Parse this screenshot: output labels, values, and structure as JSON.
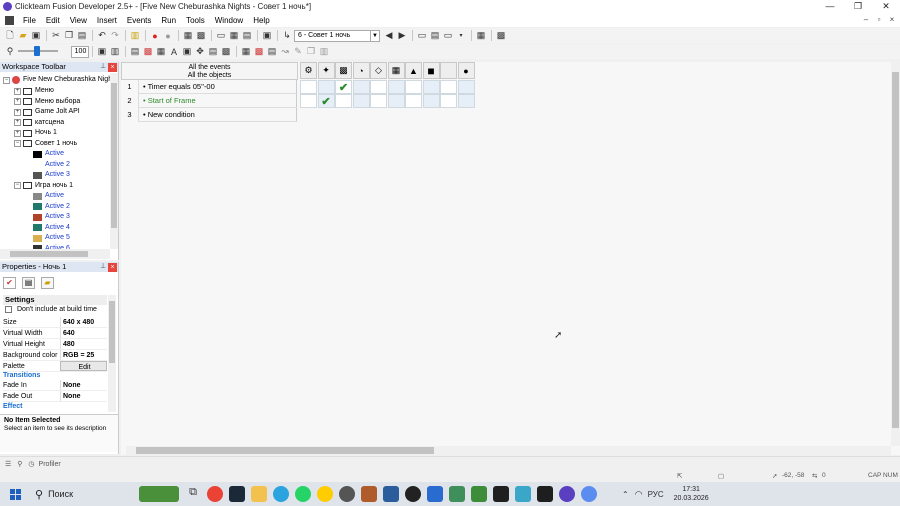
{
  "window": {
    "title": "Clickteam Fusion Developer 2.5+ - [Five New Cheburashka Nights - Совет 1 ночь*]",
    "minimize": "—",
    "restore": "❐",
    "close": "✕"
  },
  "menu": [
    "File",
    "Edit",
    "View",
    "Insert",
    "Events",
    "Run",
    "Tools",
    "Window",
    "Help"
  ],
  "toolbar": {
    "frame_combo": "6 - Совет 1 ночь",
    "zoom_value": "100"
  },
  "workspace": {
    "header": "Workspace Toolbar",
    "root": "Five New Cheburashka Nigh",
    "items": [
      {
        "label": "Меню",
        "level": 1,
        "expand": "+"
      },
      {
        "label": "Меню выбора",
        "level": 1,
        "expand": "+"
      },
      {
        "label": "Game Jolt API",
        "level": 1,
        "expand": "+"
      },
      {
        "label": "катсцена",
        "level": 1,
        "expand": "+"
      },
      {
        "label": "Ночь 1",
        "level": 1,
        "expand": "+"
      },
      {
        "label": "Совет 1 ночь",
        "level": 1,
        "expand": "−"
      },
      {
        "label": "Active",
        "level": 2,
        "expand": ""
      },
      {
        "label": "Active 2",
        "level": 2,
        "expand": ""
      },
      {
        "label": "Active 3",
        "level": 2,
        "expand": ""
      },
      {
        "label": "Игра ночь 1",
        "level": 1,
        "expand": "−"
      },
      {
        "label": "Active",
        "level": 2,
        "expand": ""
      },
      {
        "label": "Active 2",
        "level": 2,
        "expand": ""
      },
      {
        "label": "Active 3",
        "level": 2,
        "expand": ""
      },
      {
        "label": "Active 4",
        "level": 2,
        "expand": ""
      },
      {
        "label": "Active 5",
        "level": 2,
        "expand": ""
      },
      {
        "label": "Active 6",
        "level": 2,
        "expand": ""
      }
    ]
  },
  "properties": {
    "header": "Properties - Ночь 1",
    "settings_label": "Settings",
    "dont_include": "Don't include at build time",
    "rows": [
      {
        "k": "Size",
        "v": "640 x 480"
      },
      {
        "k": "Virtual Width",
        "v": "640"
      },
      {
        "k": "Virtual Height",
        "v": "480"
      },
      {
        "k": "Background color",
        "v": "RGB = 25"
      },
      {
        "k": "Palette",
        "v": "Edit"
      }
    ],
    "transitions_label": "Transitions",
    "rows2": [
      {
        "k": "Fade In",
        "v": "None"
      },
      {
        "k": "Fade Out",
        "v": "None"
      }
    ],
    "effect_label": "Effect",
    "desc_title": "No Item Selected",
    "desc_text": "Select an item to see its description"
  },
  "events": {
    "header_line1": "All the events",
    "header_line2": "All the objects",
    "rows": [
      {
        "num": "1",
        "text": "Timer equals 05''-00",
        "color": "#000000"
      },
      {
        "num": "2",
        "text": "Start of Frame",
        "color": "#2e8b2e"
      },
      {
        "num": "3",
        "text": "New condition",
        "color": "#000000"
      }
    ]
  },
  "profiler": {
    "label": "Profiler"
  },
  "status": {
    "coords": "-62, -58",
    "objects": "0",
    "caps": "CAP NUM"
  },
  "taskbar": {
    "search": "Поиск",
    "lang": "РУС",
    "time": "17:31",
    "date": "20.03.2026"
  }
}
